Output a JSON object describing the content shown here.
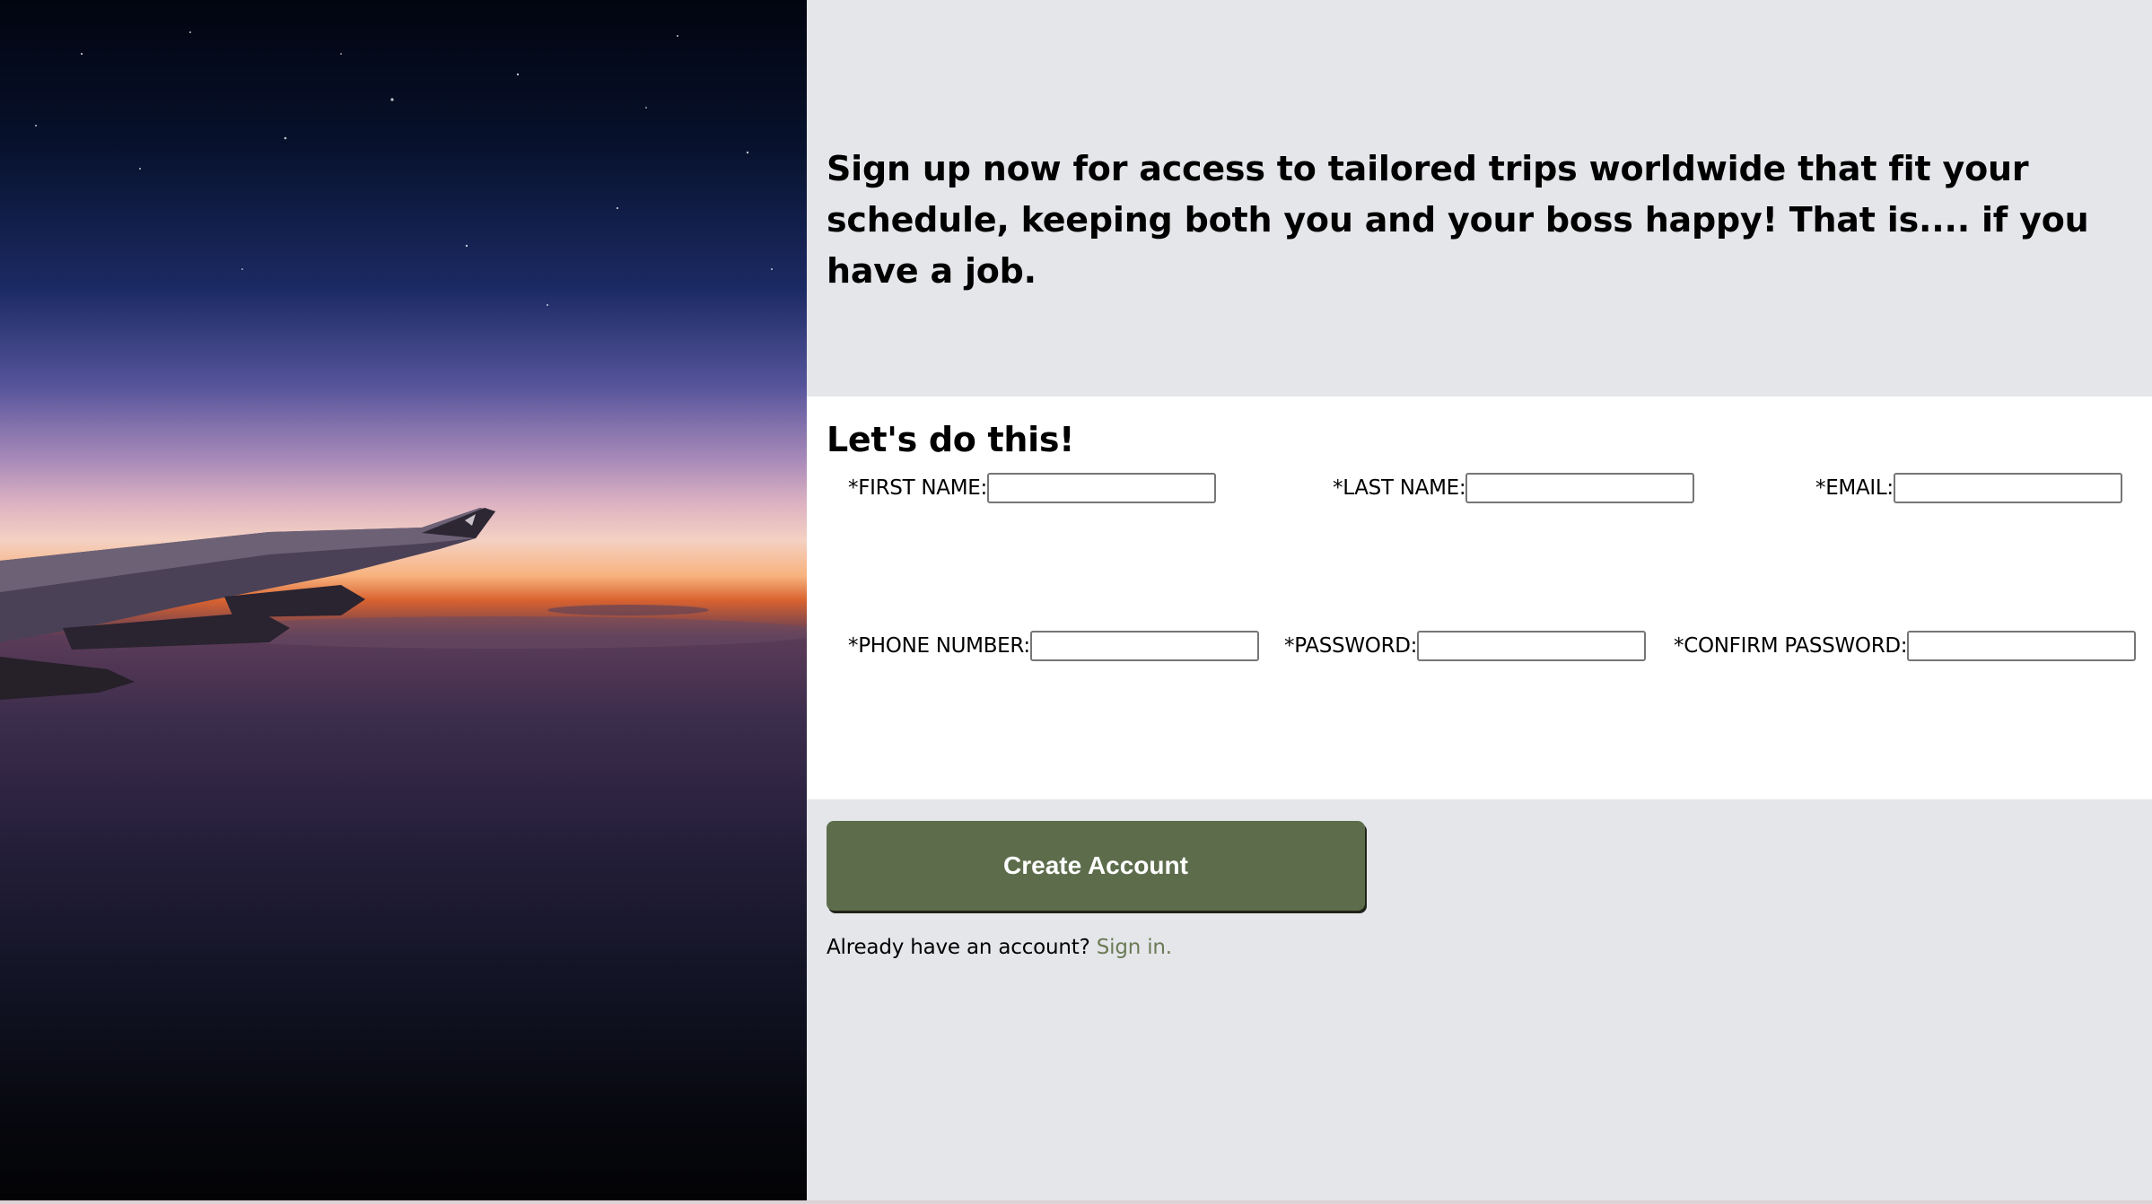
{
  "intro": {
    "headline": "Sign up now for access to tailored trips worldwide that fit your schedule, keeping both you and your boss happy! That is.... if you have a job."
  },
  "form": {
    "title": "Let's do this!",
    "fields": {
      "first_name": {
        "label": "*FIRST NAME:",
        "value": "",
        "placeholder": ""
      },
      "last_name": {
        "label": "*LAST NAME:",
        "value": "",
        "placeholder": ""
      },
      "email": {
        "label": "*EMAIL:",
        "value": "",
        "placeholder": ""
      },
      "phone": {
        "label": "*PHONE NUMBER:",
        "value": "",
        "placeholder": ""
      },
      "password": {
        "label": "*PASSWORD:",
        "value": "",
        "placeholder": ""
      },
      "confirm_password": {
        "label": "*CONFIRM PASSWORD:",
        "value": "",
        "placeholder": ""
      }
    }
  },
  "actions": {
    "create_label": "Create Account",
    "signin_prompt": "Already have an account?",
    "signin_link": "Sign in."
  },
  "colors": {
    "page_background": "#e5e6ea",
    "form_background": "#ffffff",
    "button_background": "#5d6d4c",
    "button_text": "#ffffff",
    "link": "#6a7b56"
  }
}
